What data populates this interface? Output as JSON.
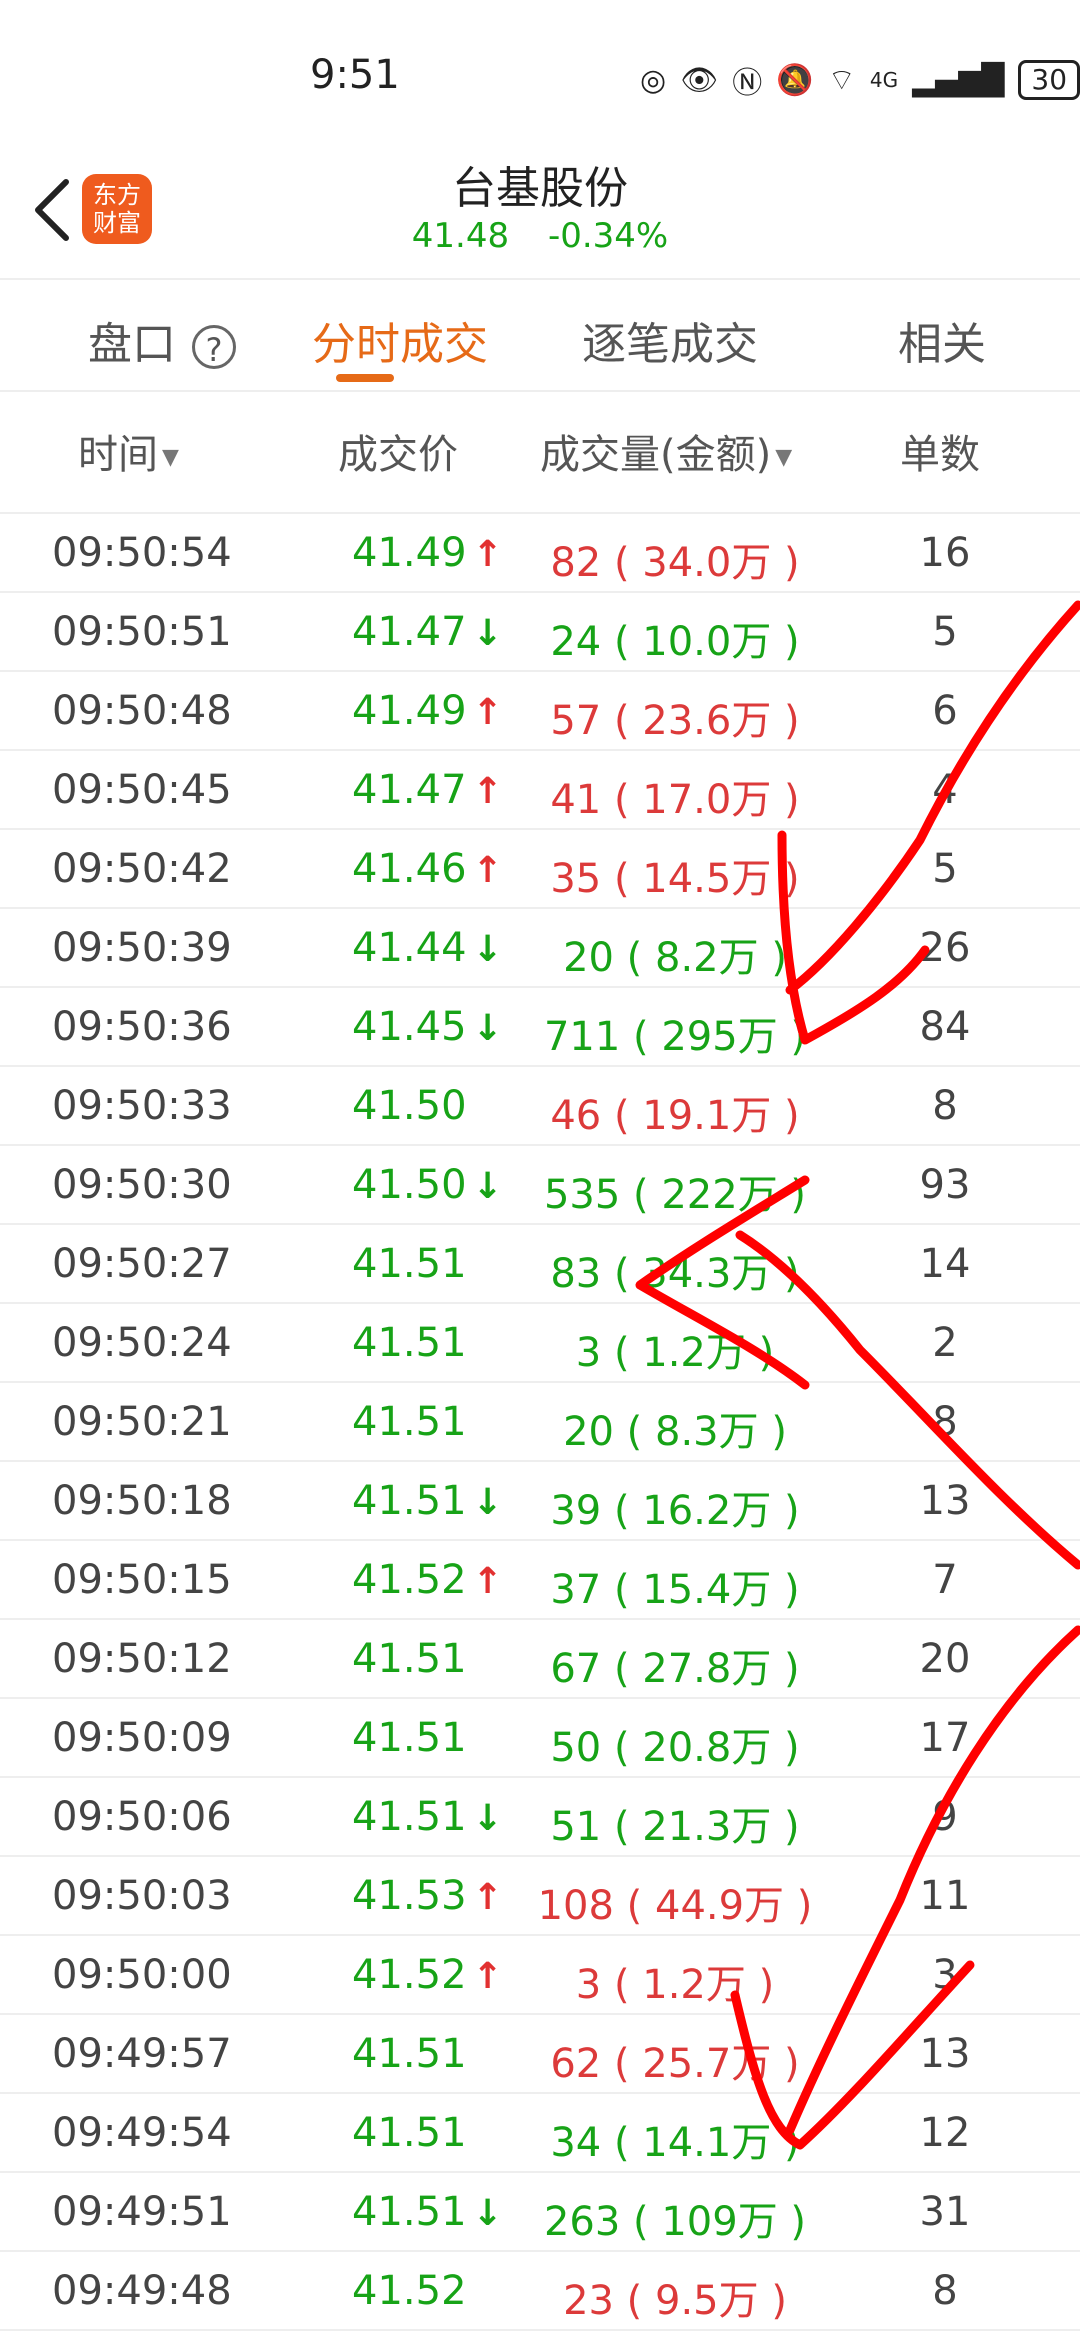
{
  "status": {
    "time": "9:51",
    "battery": "30",
    "network": "4G"
  },
  "header": {
    "name": "台基股份",
    "price": "41.48",
    "change": "-0.34%",
    "logo_line1": "东方",
    "logo_line2": "财富"
  },
  "tabs": [
    {
      "label": "盘口"
    },
    {
      "label": "分时成交"
    },
    {
      "label": "逐笔成交"
    },
    {
      "label": "相关"
    }
  ],
  "help_symbol": "?",
  "columns": {
    "time": "时间",
    "price": "成交价",
    "volume": "成交量(金额)",
    "count": "单数"
  },
  "colors": {
    "up": "#e23131",
    "down": "#17a317",
    "accent": "#e66a17",
    "annotation": "#ff0000"
  },
  "rows": [
    {
      "time": "09:50:54",
      "price": "41.49",
      "dir": "up",
      "vol": "82 ( 34.0万 )",
      "vol_color": "red",
      "count": "16"
    },
    {
      "time": "09:50:51",
      "price": "41.47",
      "dir": "down",
      "vol": "24 ( 10.0万 )",
      "vol_color": "green",
      "count": "5"
    },
    {
      "time": "09:50:48",
      "price": "41.49",
      "dir": "up",
      "vol": "57 ( 23.6万 )",
      "vol_color": "red",
      "count": "6"
    },
    {
      "time": "09:50:45",
      "price": "41.47",
      "dir": "up",
      "vol": "41 ( 17.0万 )",
      "vol_color": "red",
      "count": "4"
    },
    {
      "time": "09:50:42",
      "price": "41.46",
      "dir": "up",
      "vol": "35 ( 14.5万 )",
      "vol_color": "red",
      "count": "5"
    },
    {
      "time": "09:50:39",
      "price": "41.44",
      "dir": "down",
      "vol": "20 ( 8.2万 )",
      "vol_color": "green",
      "count": "26"
    },
    {
      "time": "09:50:36",
      "price": "41.45",
      "dir": "down",
      "vol": "711 ( 295万 )",
      "vol_color": "green",
      "count": "84"
    },
    {
      "time": "09:50:33",
      "price": "41.50",
      "dir": "",
      "vol": "46 ( 19.1万 )",
      "vol_color": "red",
      "count": "8"
    },
    {
      "time": "09:50:30",
      "price": "41.50",
      "dir": "down",
      "vol": "535 ( 222万 )",
      "vol_color": "green",
      "count": "93"
    },
    {
      "time": "09:50:27",
      "price": "41.51",
      "dir": "",
      "vol": "83 ( 34.3万 )",
      "vol_color": "green",
      "count": "14"
    },
    {
      "time": "09:50:24",
      "price": "41.51",
      "dir": "",
      "vol": "3 ( 1.2万 )",
      "vol_color": "green",
      "count": "2"
    },
    {
      "time": "09:50:21",
      "price": "41.51",
      "dir": "",
      "vol": "20 ( 8.3万 )",
      "vol_color": "green",
      "count": "8"
    },
    {
      "time": "09:50:18",
      "price": "41.51",
      "dir": "down",
      "vol": "39 ( 16.2万 )",
      "vol_color": "green",
      "count": "13"
    },
    {
      "time": "09:50:15",
      "price": "41.52",
      "dir": "up",
      "vol": "37 ( 15.4万 )",
      "vol_color": "green",
      "count": "7"
    },
    {
      "time": "09:50:12",
      "price": "41.51",
      "dir": "",
      "vol": "67 ( 27.8万 )",
      "vol_color": "green",
      "count": "20"
    },
    {
      "time": "09:50:09",
      "price": "41.51",
      "dir": "",
      "vol": "50 ( 20.8万 )",
      "vol_color": "green",
      "count": "17"
    },
    {
      "time": "09:50:06",
      "price": "41.51",
      "dir": "down",
      "vol": "51 ( 21.3万 )",
      "vol_color": "green",
      "count": "9"
    },
    {
      "time": "09:50:03",
      "price": "41.53",
      "dir": "up",
      "vol": "108 ( 44.9万 )",
      "vol_color": "red",
      "count": "11"
    },
    {
      "time": "09:50:00",
      "price": "41.52",
      "dir": "up",
      "vol": "3 ( 1.2万 )",
      "vol_color": "red",
      "count": "3"
    },
    {
      "time": "09:49:57",
      "price": "41.51",
      "dir": "",
      "vol": "62 ( 25.7万 )",
      "vol_color": "red",
      "count": "13"
    },
    {
      "time": "09:49:54",
      "price": "41.51",
      "dir": "",
      "vol": "34 ( 14.1万 )",
      "vol_color": "green",
      "count": "12"
    },
    {
      "time": "09:49:51",
      "price": "41.51",
      "dir": "down",
      "vol": "263 ( 109万 )",
      "vol_color": "green",
      "count": "31"
    },
    {
      "time": "09:49:48",
      "price": "41.52",
      "dir": "",
      "vol": "23 ( 9.5万 )",
      "vol_color": "red",
      "count": "8"
    }
  ]
}
